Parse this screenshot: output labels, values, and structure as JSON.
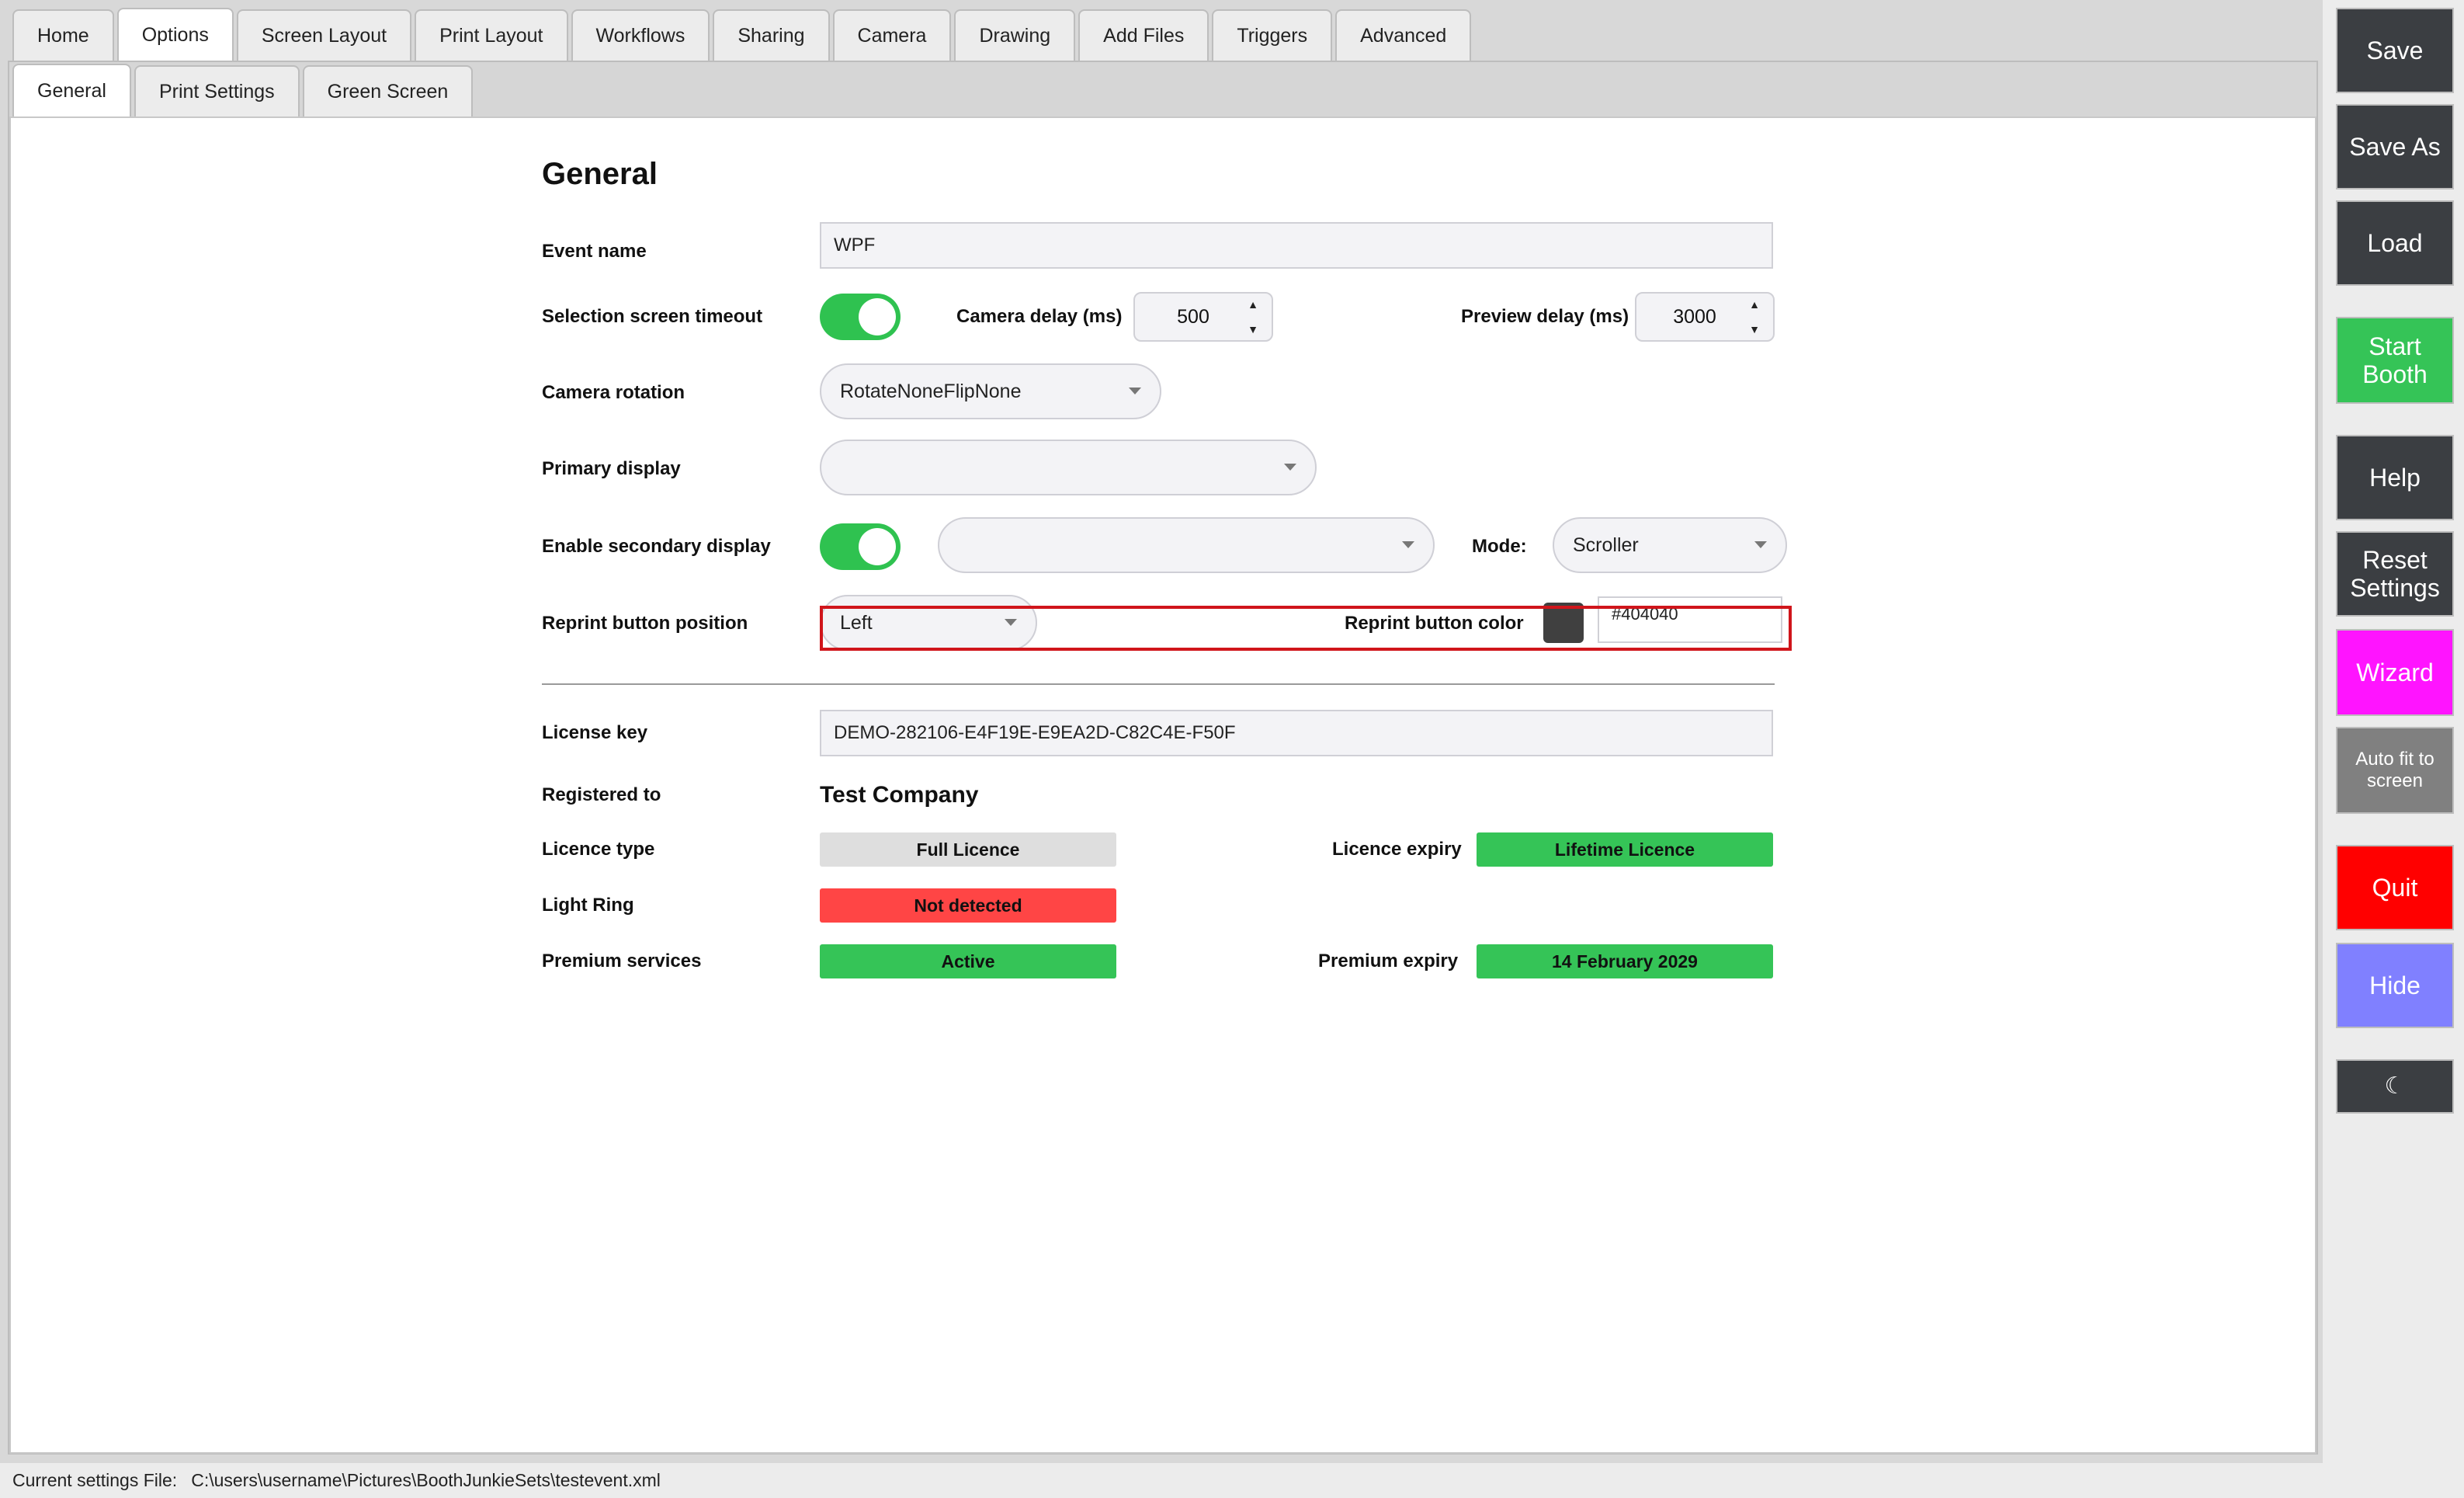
{
  "tabs": [
    "Home",
    "Options",
    "Screen Layout",
    "Print Layout",
    "Workflows",
    "Sharing",
    "Camera",
    "Drawing",
    "Add Files",
    "Triggers",
    "Advanced"
  ],
  "active_tab": "Options",
  "subtabs": [
    "General",
    "Print Settings",
    "Green Screen"
  ],
  "active_subtab": "General",
  "general": {
    "heading": "General",
    "event_name_label": "Event name",
    "event_name_value": "WPF",
    "selection_timeout_label": "Selection screen timeout",
    "selection_timeout_on": true,
    "camera_delay_label": "Camera delay (ms)",
    "camera_delay_value": "500",
    "preview_delay_label": "Preview delay (ms)",
    "preview_delay_value": "3000",
    "camera_rotation_label": "Camera rotation",
    "camera_rotation_value": "RotateNoneFlipNone",
    "primary_display_label": "Primary display",
    "primary_display_value": "",
    "secondary_display_label": "Enable secondary display",
    "secondary_display_on": true,
    "secondary_display_value": "",
    "mode_label": "Mode:",
    "mode_value": "Scroller",
    "reprint_position_label": "Reprint button position",
    "reprint_position_value": "Left",
    "reprint_color_label": "Reprint button color",
    "reprint_color_value": "#404040"
  },
  "license": {
    "license_key_label": "License key",
    "license_key_value": "DEMO-282106-E4F19E-E9EA2D-C82C4E-F50F",
    "registered_to_label": "Registered to",
    "registered_to_value": "Test Company",
    "licence_type_label": "Licence type",
    "licence_type_value": "Full Licence",
    "licence_expiry_label": "Licence expiry",
    "licence_expiry_value": "Lifetime Licence",
    "light_ring_label": "Light Ring",
    "light_ring_value": "Not detected",
    "premium_services_label": "Premium services",
    "premium_services_value": "Active",
    "premium_expiry_label": "Premium expiry",
    "premium_expiry_value": "14 February 2029"
  },
  "sidebar": {
    "save": "Save",
    "save_as": "Save As",
    "load": "Load",
    "start_booth": "Start Booth",
    "help": "Help",
    "reset_settings": "Reset Settings",
    "wizard": "Wizard",
    "auto_fit": "Auto fit to screen",
    "quit": "Quit",
    "hide": "Hide",
    "theme_icon": "☾"
  },
  "status": {
    "label": "Current settings File:",
    "path": "C:\\users\\username\\Pictures\\BoothJunkieSets\\testevent.xml"
  },
  "colors": {
    "toggle_on": "#2fc250",
    "badge_grey": "#dedede",
    "badge_green": "#35c457",
    "badge_red": "#ff4545",
    "highlight": "#d0151b",
    "sidebar_dark": "#3b3e42",
    "start_green": "#35c457",
    "wizard_magenta": "#ff14ff",
    "auto_fit_grey": "#808080",
    "quit_red": "#ff0000",
    "hide_blue": "#8080ff"
  }
}
